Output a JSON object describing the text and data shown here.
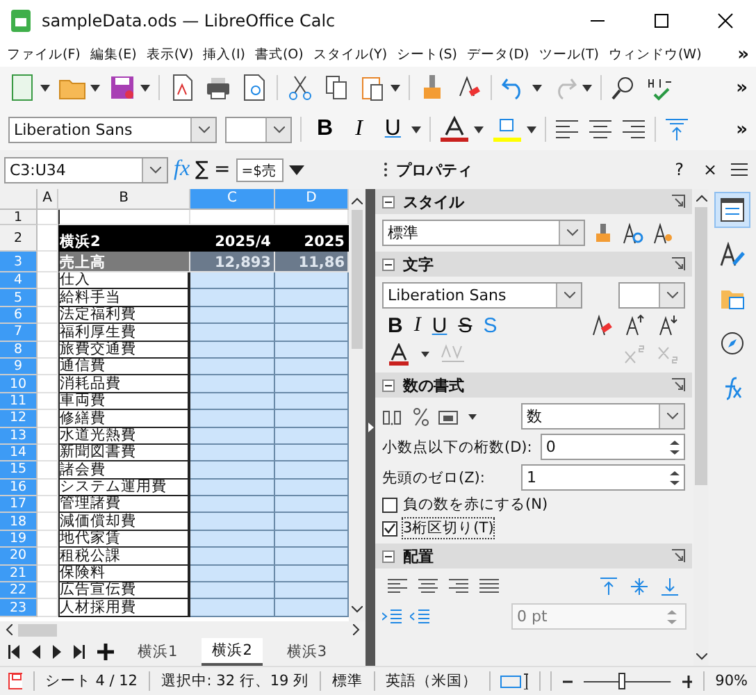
{
  "window": {
    "title": "sampleData.ods — LibreOffice Calc"
  },
  "menu": {
    "items": [
      "ファイル(F)",
      "編集(E)",
      "表示(V)",
      "挿入(I)",
      "書式(O)",
      "スタイル(Y)",
      "シート(S)",
      "データ(D)",
      "ツール(T)",
      "ウィンドウ(W)"
    ],
    "overflow": "»"
  },
  "toolbar": {
    "overflow": "»"
  },
  "format_toolbar": {
    "font": "Liberation Sans",
    "buttons": [
      "B",
      "I",
      "U"
    ],
    "overflow": "»"
  },
  "formula_bar": {
    "name_box": "C3:U34",
    "buttons": [
      "fx",
      "∑",
      "="
    ],
    "formula": "=$売"
  },
  "sheet": {
    "columns": [
      {
        "label": "A",
        "selected": false
      },
      {
        "label": "B",
        "selected": false
      },
      {
        "label": "C",
        "selected": true
      },
      {
        "label": "D",
        "selected": true
      }
    ],
    "rows": [
      {
        "number": "1",
        "selected": false,
        "kind": "blank"
      },
      {
        "number": "2",
        "selected": false,
        "kind": "title",
        "label": "横浜2",
        "values": [
          "2025/4",
          "2025"
        ]
      },
      {
        "number": "3",
        "selected": true,
        "kind": "total",
        "label": "売上高",
        "values": [
          "12,893",
          "11,86"
        ]
      },
      {
        "number": "4",
        "selected": true,
        "kind": "item",
        "label": "仕入"
      },
      {
        "number": "5",
        "selected": true,
        "kind": "item",
        "label": "給料手当"
      },
      {
        "number": "6",
        "selected": true,
        "kind": "item",
        "label": "法定福利費"
      },
      {
        "number": "7",
        "selected": true,
        "kind": "item",
        "label": "福利厚生費"
      },
      {
        "number": "8",
        "selected": true,
        "kind": "item",
        "label": "旅費交通費"
      },
      {
        "number": "9",
        "selected": true,
        "kind": "item",
        "label": "通信費"
      },
      {
        "number": "10",
        "selected": true,
        "kind": "item",
        "label": "消耗品費"
      },
      {
        "number": "11",
        "selected": true,
        "kind": "item",
        "label": "車両費"
      },
      {
        "number": "12",
        "selected": true,
        "kind": "item",
        "label": "修繕費"
      },
      {
        "number": "13",
        "selected": true,
        "kind": "item",
        "label": "水道光熱費"
      },
      {
        "number": "14",
        "selected": true,
        "kind": "item",
        "label": "新聞図書費"
      },
      {
        "number": "15",
        "selected": true,
        "kind": "item",
        "label": "諸会費"
      },
      {
        "number": "16",
        "selected": true,
        "kind": "item",
        "label": "システム運用費"
      },
      {
        "number": "17",
        "selected": true,
        "kind": "item",
        "label": "管理諸費"
      },
      {
        "number": "18",
        "selected": true,
        "kind": "item",
        "label": "減価償却費"
      },
      {
        "number": "19",
        "selected": true,
        "kind": "item",
        "label": "地代家賃"
      },
      {
        "number": "20",
        "selected": true,
        "kind": "item",
        "label": "租税公課"
      },
      {
        "number": "21",
        "selected": true,
        "kind": "item",
        "label": "保険料"
      },
      {
        "number": "22",
        "selected": true,
        "kind": "item",
        "label": "広告宣伝費"
      },
      {
        "number": "23",
        "selected": true,
        "kind": "item",
        "label": "人材採用費"
      }
    ]
  },
  "sheet_tabs": [
    {
      "label": "横浜1",
      "selected": false
    },
    {
      "label": "横浜2",
      "selected": true
    },
    {
      "label": "横浜3",
      "selected": false
    }
  ],
  "panel": {
    "title": "プロパティ",
    "help": "?",
    "close": "×",
    "style_section": {
      "title": "スタイル",
      "expanded": true,
      "style": "標準"
    },
    "character_section": {
      "title": "文字",
      "expanded": true,
      "font": "Liberation Sans",
      "buttons": [
        "B",
        "I",
        "U",
        "S",
        "S"
      ]
    },
    "number_section": {
      "title": "数の書式",
      "expanded": true,
      "category": "数",
      "fields": [
        {
          "label": "小数点以下の桁数(D):",
          "value": "0"
        },
        {
          "label": "先頭のゼロ(Z):",
          "value": "1"
        }
      ],
      "options": [
        {
          "label": "負の数を赤にする(N)",
          "checked": false
        },
        {
          "label": "3桁区切り(T)",
          "checked": true
        }
      ]
    },
    "alignment_section": {
      "title": "配置",
      "expanded": true,
      "indent_placeholder": "0 pt"
    }
  },
  "sidebar_tabs": [
    {
      "kind": "properties",
      "selected": true
    },
    {
      "kind": "styles",
      "selected": false
    },
    {
      "kind": "gallery",
      "selected": false
    },
    {
      "kind": "navigator",
      "selected": false
    },
    {
      "kind": "functions",
      "selected": false
    }
  ],
  "status_bar": {
    "sheet": "シート 4 / 12",
    "selection": "選択中: 32 行、19 列",
    "page_style": "標準",
    "language": "英語（米国）",
    "zoom": {
      "level": 0.45,
      "reading": "90%"
    }
  }
}
